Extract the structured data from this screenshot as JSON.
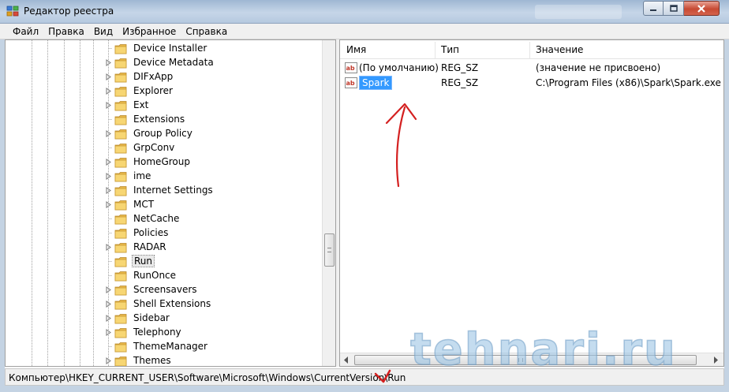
{
  "window": {
    "title": "Редактор реестра",
    "icon": "registry-editor-icon",
    "controls": [
      "minimize-icon",
      "maximize-icon",
      "close-icon"
    ]
  },
  "menu": [
    {
      "label": "Файл"
    },
    {
      "label": "Правка"
    },
    {
      "label": "Вид"
    },
    {
      "label": "Избранное"
    },
    {
      "label": "Справка"
    }
  ],
  "tree": {
    "items": [
      {
        "label": "Device Installer",
        "expandable": false
      },
      {
        "label": "Device Metadata",
        "expandable": true
      },
      {
        "label": "DIFxApp",
        "expandable": true
      },
      {
        "label": "Explorer",
        "expandable": true
      },
      {
        "label": "Ext",
        "expandable": true
      },
      {
        "label": "Extensions",
        "expandable": false
      },
      {
        "label": "Group Policy",
        "expandable": true
      },
      {
        "label": "GrpConv",
        "expandable": false
      },
      {
        "label": "HomeGroup",
        "expandable": true
      },
      {
        "label": "ime",
        "expandable": true
      },
      {
        "label": "Internet Settings",
        "expandable": true
      },
      {
        "label": "MCT",
        "expandable": true
      },
      {
        "label": "NetCache",
        "expandable": false
      },
      {
        "label": "Policies",
        "expandable": false
      },
      {
        "label": "RADAR",
        "expandable": true
      },
      {
        "label": "Run",
        "expandable": false,
        "selected": true
      },
      {
        "label": "RunOnce",
        "expandable": false
      },
      {
        "label": "Screensavers",
        "expandable": true
      },
      {
        "label": "Shell Extensions",
        "expandable": true
      },
      {
        "label": "Sidebar",
        "expandable": true
      },
      {
        "label": "Telephony",
        "expandable": true
      },
      {
        "label": "ThemeManager",
        "expandable": false
      },
      {
        "label": "Themes",
        "expandable": true
      }
    ]
  },
  "list": {
    "columns": {
      "name": "Имя",
      "type": "Тип",
      "value": "Значение"
    },
    "rows": [
      {
        "name": "(По умолчанию)",
        "type": "REG_SZ",
        "value": "(значение не присвоено)",
        "icon": "string-value-icon",
        "selected": false
      },
      {
        "name": "Spark",
        "type": "REG_SZ",
        "value": "C:\\Program Files (x86)\\Spark\\Spark.exe",
        "icon": "string-value-icon",
        "selected": true
      }
    ]
  },
  "status": {
    "path": "Компьютер\\HKEY_CURRENT_USER\\Software\\Microsoft\\Windows\\CurrentVersion\\Run"
  },
  "watermark": {
    "text": "tehnari.ru"
  },
  "annotation_colors": {
    "arrow": "#d42020",
    "selection": "#3399ff",
    "watermark": "#7fb0d8"
  }
}
